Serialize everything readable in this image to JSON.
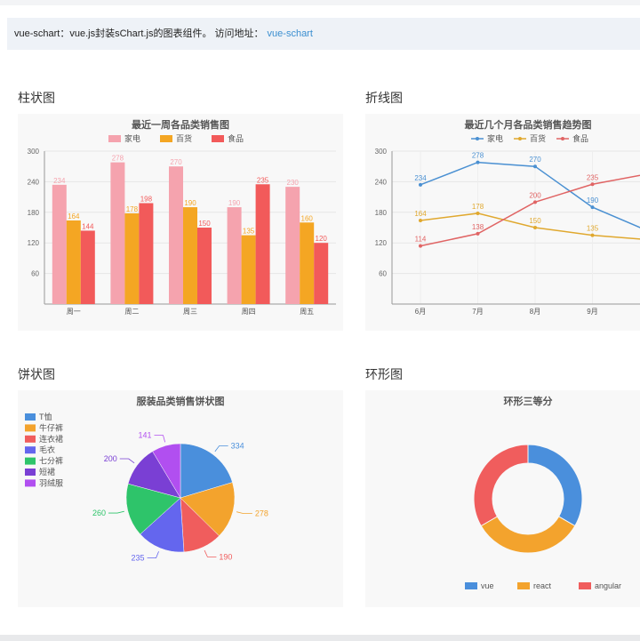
{
  "notice": {
    "text": "vue-schart：vue.js封装sChart.js的图表组件。 访问地址：",
    "link_text": "vue-schart"
  },
  "sections": {
    "bar_title": "柱状图",
    "line_title": "折线图",
    "pie_title": "饼状图",
    "ring_title": "环形图"
  },
  "chart_data": [
    {
      "type": "bar",
      "title": "最近一周各品类销售图",
      "categories": [
        "周一",
        "周二",
        "周三",
        "周四",
        "周五"
      ],
      "series": [
        {
          "name": "家电",
          "color": "#f5a3ae",
          "values": [
            234,
            278,
            270,
            190,
            230
          ]
        },
        {
          "name": "百货",
          "color": "#f4a623",
          "values": [
            164,
            178,
            190,
            135,
            160
          ]
        },
        {
          "name": "食品",
          "color": "#f25a5a",
          "values": [
            144,
            198,
            150,
            235,
            120
          ]
        }
      ],
      "yticks": [
        60,
        120,
        180,
        240,
        300
      ],
      "ylim": [
        0,
        300
      ]
    },
    {
      "type": "line",
      "title": "最近几个月各品类销售趋势图",
      "categories": [
        "6月",
        "7月",
        "8月",
        "9月"
      ],
      "series": [
        {
          "name": "家电",
          "color": "#4a90d2",
          "values": [
            234,
            278,
            270,
            190
          ]
        },
        {
          "name": "百货",
          "color": "#e0a82e",
          "values": [
            164,
            178,
            150,
            135
          ]
        },
        {
          "name": "食品",
          "color": "#e06464",
          "values": [
            114,
            138,
            200,
            235
          ]
        }
      ],
      "yticks": [
        60,
        120,
        180,
        240,
        300
      ],
      "ylim": [
        0,
        300
      ]
    },
    {
      "type": "pie",
      "title": "服装品类销售饼状图",
      "slices": [
        {
          "name": "T恤",
          "value": 334,
          "color": "#4a8fdc"
        },
        {
          "name": "牛仔裤",
          "value": 278,
          "color": "#f3a32d"
        },
        {
          "name": "连衣裙",
          "value": 190,
          "color": "#f05d5d"
        },
        {
          "name": "毛衣",
          "value": 235,
          "color": "#6466ee"
        },
        {
          "name": "七分裤",
          "value": 260,
          "color": "#2ec46a"
        },
        {
          "name": "短裙",
          "value": 200,
          "color": "#7a3fd4"
        },
        {
          "name": "羽绒服",
          "value": 141,
          "color": "#b14ff0"
        }
      ]
    },
    {
      "type": "pie",
      "title": "环形三等分",
      "slices": [
        {
          "name": "vue",
          "value": 1,
          "color": "#4a8fdc"
        },
        {
          "name": "react",
          "value": 1,
          "color": "#f3a32d"
        },
        {
          "name": "angular",
          "value": 1,
          "color": "#f05d5d"
        }
      ]
    }
  ]
}
